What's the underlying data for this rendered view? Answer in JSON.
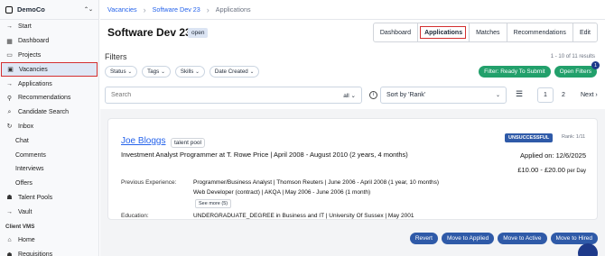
{
  "sidebar": {
    "org_name": "DemoCo",
    "items": [
      {
        "label": "Start",
        "icon": "arrow-right-icon",
        "glyph": "→"
      },
      {
        "label": "Dashboard",
        "icon": "grid-icon",
        "glyph": "▦"
      },
      {
        "label": "Projects",
        "icon": "folder-icon",
        "glyph": "▭"
      },
      {
        "label": "Vacancies",
        "icon": "briefcase-icon",
        "glyph": "▣",
        "active": true
      },
      {
        "label": "Applications",
        "icon": "arrow-right-icon",
        "glyph": "→"
      },
      {
        "label": "Recommendations",
        "icon": "pin-icon",
        "glyph": "⚲"
      },
      {
        "label": "Candidate Search",
        "icon": "search-icon",
        "glyph": "⌕"
      },
      {
        "label": "Inbox",
        "icon": "refresh-icon",
        "glyph": "↻"
      },
      {
        "label": "Chat",
        "sub": true
      },
      {
        "label": "Comments",
        "sub": true
      },
      {
        "label": "Interviews",
        "sub": true
      },
      {
        "label": "Offers",
        "sub": true
      },
      {
        "label": "Talent Pools",
        "icon": "users-icon",
        "glyph": "☗"
      },
      {
        "label": "Vault",
        "icon": "arrow-right-icon",
        "glyph": "→"
      },
      {
        "label": "Client VMS",
        "section": true
      },
      {
        "label": "Home",
        "icon": "home-icon",
        "glyph": "⌂"
      },
      {
        "label": "Requisitions",
        "icon": "people-icon",
        "glyph": "☗"
      }
    ]
  },
  "breadcrumb": [
    "Vacancies",
    "Software Dev 23",
    "Applications"
  ],
  "header": {
    "title": "Software Dev 23",
    "status": "open",
    "tabs": [
      "Dashboard",
      "Applications",
      "Matches",
      "Recommendations",
      "Edit"
    ],
    "active_tab": "Applications"
  },
  "filters": {
    "label": "Filters",
    "result_count": "1 - 10 of 11 results",
    "chips": [
      "Status",
      "Tags",
      "Skills",
      "Date Created"
    ],
    "ready_btn": "Filter: Ready To Submit",
    "open_filters_btn": "Open Filters",
    "open_filters_count": "1"
  },
  "search": {
    "placeholder": "Search",
    "scope": "all",
    "sort": "Sort by 'Rank'",
    "pages": [
      "1",
      "2"
    ],
    "next": "Next"
  },
  "candidate": {
    "name": "Joe Bloggs",
    "tag": "talent pool",
    "role": "Investment Analyst Programmer at T. Rowe Price | April 2008 - August 2010 (2 years, 4 months)",
    "status": "UNSUCCESSFUL",
    "rank": "Rank: 1/11",
    "applied": "Applied on: 12/6/2025",
    "pay": "£10.00 - £20.00",
    "pay_unit": "per Day",
    "experience_label": "Previous Experience:",
    "experience": [
      "Programmer/Business Analyst | Thomson Reuters | June 2006 - April 2008 (1 year, 10 months)",
      "Web Developer (contract) | AKQA | May 2006 - June 2006 (1 month)"
    ],
    "see_more": "See more (5)",
    "education_label": "Education:",
    "education": "UNDERGRADUATE_DEGREE in Business and IT | University Of Sussex | May 2001"
  },
  "actions": [
    "Revert",
    "Move to Applied",
    "Move to Active",
    "Move to Hired"
  ]
}
